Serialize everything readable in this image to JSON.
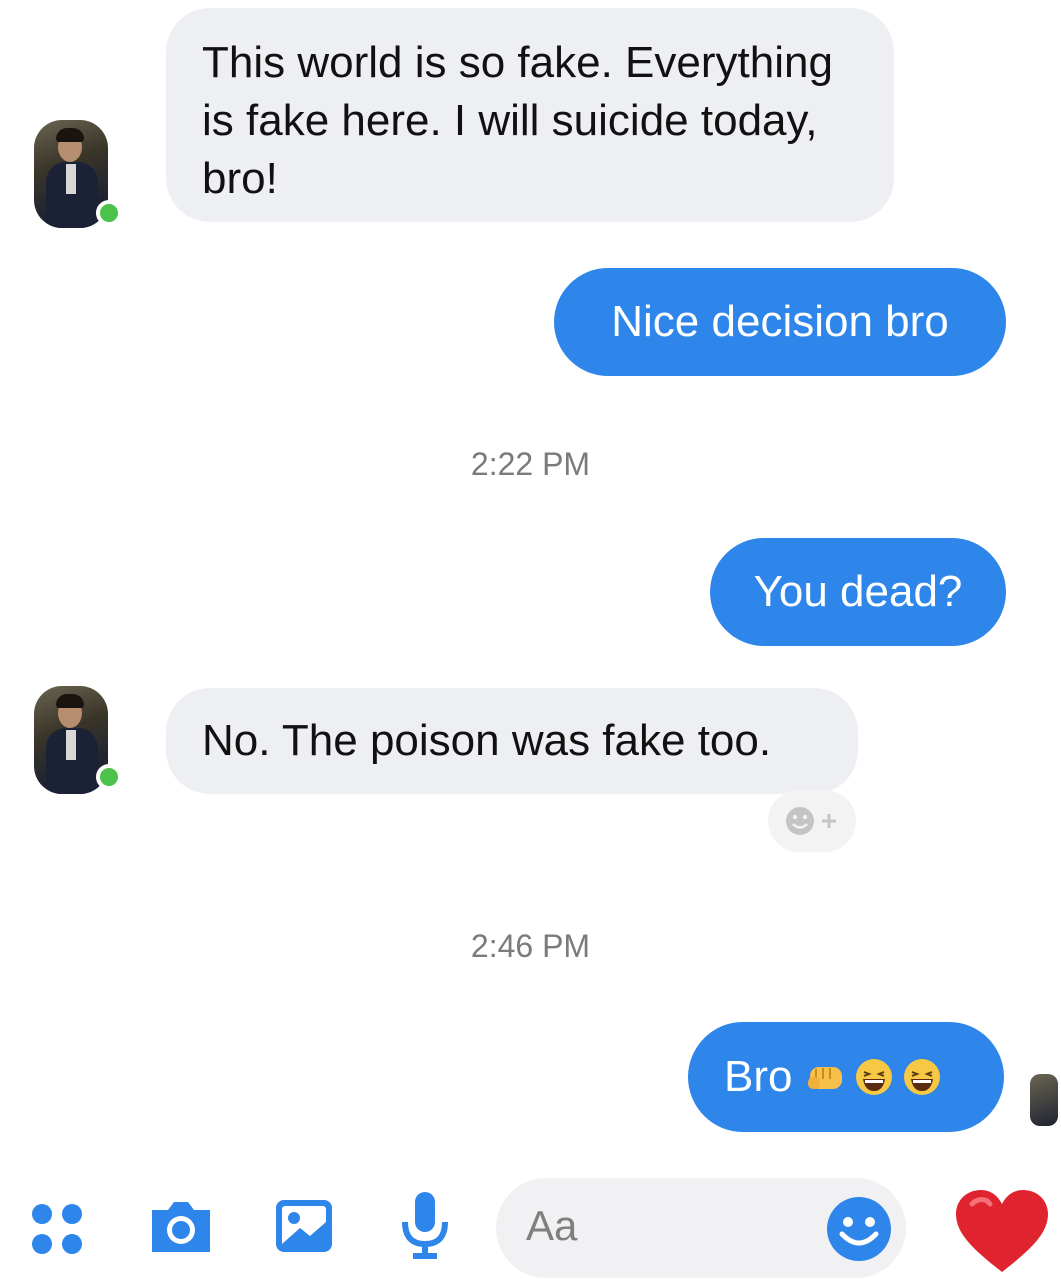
{
  "messages": [
    {
      "side": "incoming",
      "text": "This world is so fake. Everything is fake here. I will suicide today, bro!"
    },
    {
      "side": "outgoing",
      "text": "Nice decision bro"
    },
    {
      "side": "outgoing",
      "text": "You dead?"
    },
    {
      "side": "incoming",
      "text": "No. The poison was fake too."
    },
    {
      "side": "outgoing",
      "text": "Bro",
      "emojis": [
        "punch-icon",
        "laughing-icon",
        "laughing-icon"
      ]
    }
  ],
  "timestamps": [
    "2:22 PM",
    "2:46 PM"
  ],
  "composer": {
    "placeholder": "Aa",
    "icons": [
      "menu-dots-icon",
      "camera-icon",
      "gallery-icon",
      "microphone-icon",
      "smiley-icon",
      "heart-icon"
    ]
  },
  "colors": {
    "outgoing_bubble": "#2e86ea",
    "incoming_bubble": "#eeeff2",
    "online_indicator": "#4cc14b",
    "heart": "#e0242f"
  }
}
